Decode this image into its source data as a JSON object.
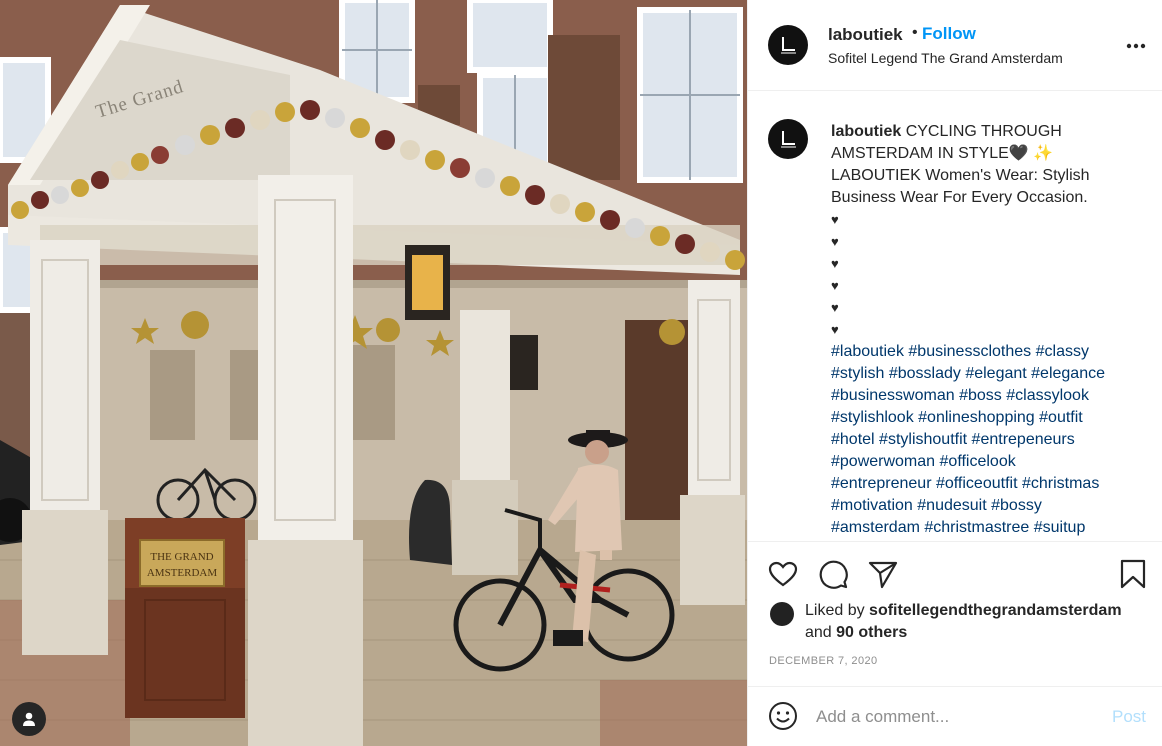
{
  "header": {
    "username": "laboutiek",
    "separator": "•",
    "follow_label": "Follow",
    "location": "Sofitel Legend The Grand Amsterdam",
    "more_icon": "more-horizontal-icon"
  },
  "photo": {
    "signage": {
      "portico_text": "The Grand",
      "podium_line1": "THE GRAND",
      "podium_line2": "AMSTERDAM"
    },
    "user_tag_icon": "person-icon"
  },
  "caption": {
    "username": "laboutiek",
    "lines": [
      "CYCLING THROUGH",
      "AMSTERDAM IN STYLE🖤 ✨",
      "LABOUTIEK Women's Wear: Stylish",
      "Business Wear For Every Occasion."
    ],
    "hearts": [
      "♥",
      "♥",
      "♥",
      "♥",
      "♥",
      "♥"
    ],
    "hashtags": [
      [
        "#laboutiek",
        "#businessclothes",
        "#classy"
      ],
      [
        "#stylish",
        "#bosslady",
        "#elegant",
        "#elegance"
      ],
      [
        "#businesswoman",
        "#boss",
        "#classylook"
      ],
      [
        "#stylishlook",
        "#onlineshopping",
        "#outfit"
      ],
      [
        "#hotel",
        "#stylishoutfit",
        "#entrepeneurs"
      ],
      [
        "#powerwoman",
        "#officelook"
      ],
      [
        "#entrepreneur",
        "#officeoutfit",
        "#christmas"
      ],
      [
        "#motivation",
        "#nudesuit",
        "#bossy"
      ],
      [
        "#amsterdam",
        "#christmastree",
        "#suitup"
      ]
    ]
  },
  "actions": {
    "icons": [
      "heart-icon",
      "comment-icon",
      "share-icon",
      "bookmark-icon"
    ],
    "liked_prefix": "Liked by",
    "liked_user": "sofitellegendthegrandamsterdam",
    "liked_and": "and",
    "liked_others": "90 others",
    "date": "DECEMBER 7, 2020"
  },
  "comment": {
    "placeholder": "Add a comment...",
    "post_label": "Post",
    "emoji_icon": "smiley-icon"
  },
  "colors": {
    "link_blue": "#0095f6",
    "hashtag": "#00376b",
    "post_disabled": "#b2dffc",
    "muted": "#8e8e8e",
    "text": "#262626"
  }
}
